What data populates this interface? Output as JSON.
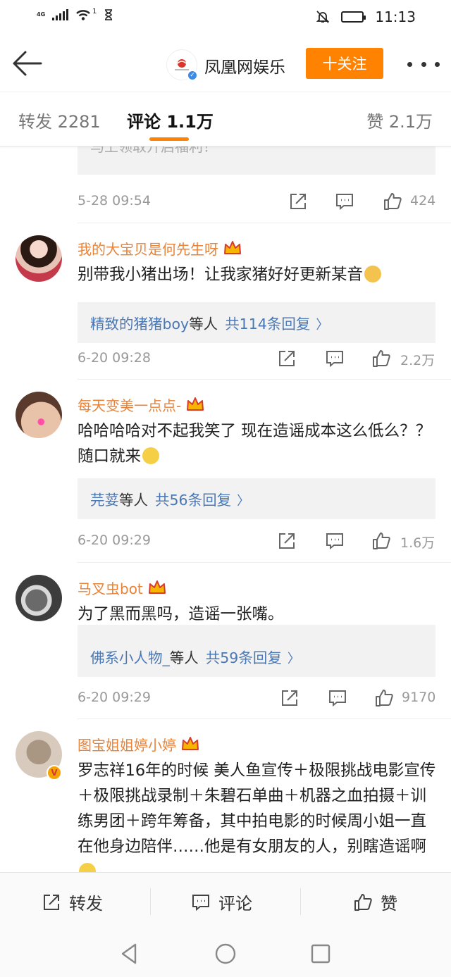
{
  "status_bar": {
    "network": "4G",
    "wifi_badge": "1",
    "time": "11:13"
  },
  "header": {
    "account_name": "凤凰网娱乐",
    "follow_label": "十关注",
    "icons": [
      "back-arrow-icon",
      "brand-logo-icon",
      "verified-badge-icon",
      "more-dots-icon"
    ]
  },
  "tabs": {
    "repost": "转发 2281",
    "comment": "评论 1.1万",
    "like": "赞 2.1万"
  },
  "cut_reply_text": "马上领取开启福利！",
  "first_meta": {
    "time": "5-28 09:54",
    "likes": "424"
  },
  "comments": [
    {
      "username": "我的大宝贝是何先生呀",
      "text": "别带我小猪出场！让我家猪好好更新某音",
      "reply_names": "精致的猪猪boy",
      "reply_etc": "等人",
      "reply_total": "共114条回复",
      "time": "6-20 09:28",
      "likes": "2.2万"
    },
    {
      "username": "每天变美一点点-",
      "text": "哈哈哈哈对不起我笑了 现在造谣成本这么低么？？随口就来",
      "reply_names": "芫荽",
      "reply_etc": "等人",
      "reply_total": "共56条回复",
      "time": "6-20 09:29",
      "likes": "1.6万"
    },
    {
      "username": "马叉虫bot",
      "text": "为了黑而黑吗，造谣一张嘴。",
      "reply_names": "佛系小人物_",
      "reply_etc": "等人",
      "reply_total": "共59条回复",
      "time": "6-20 09:29",
      "likes": "9170"
    },
    {
      "username": "图宝姐姐婷小婷",
      "text": "罗志祥16年的时候 美人鱼宣传＋极限挑战电影宣传＋极限挑战录制＋朱碧石单曲＋机器之血拍摄＋训练男团＋跨年筹备，其中拍电影的时候周小姐一直在他身边陪伴……他是有女朋友的人，别瞎造谣啊"
    }
  ],
  "bottom_bar": {
    "repost": "转发",
    "comment": "评论",
    "like": "赞"
  },
  "colors": {
    "accent": "#ff8200",
    "username": "#e8833a",
    "link": "#4a78b5",
    "muted": "#999999"
  }
}
